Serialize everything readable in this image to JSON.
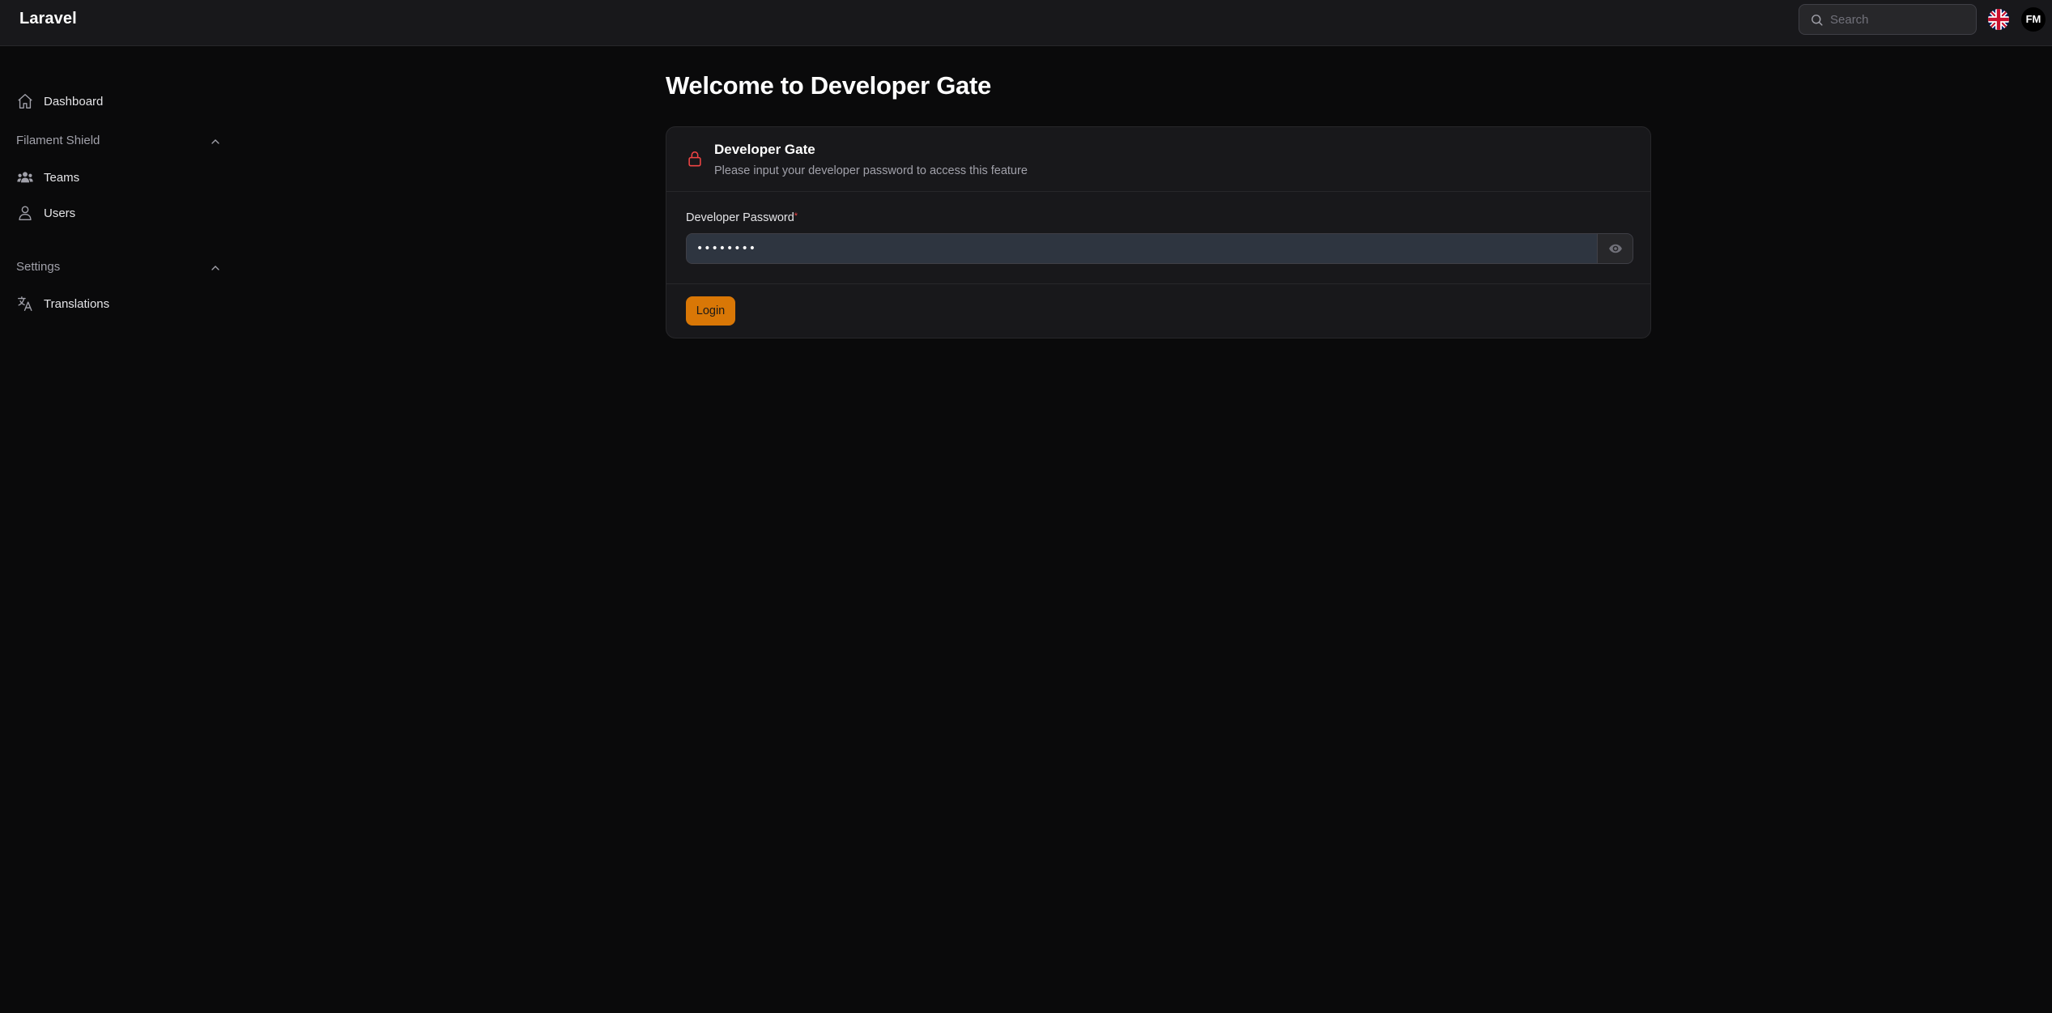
{
  "app": {
    "brand": "Laravel"
  },
  "topbar": {
    "search_placeholder": "Search",
    "avatar_initials": "FM"
  },
  "sidebar": {
    "dashboard": "Dashboard",
    "groups": [
      {
        "label": "Filament Shield",
        "items": [
          "Teams",
          "Users"
        ]
      },
      {
        "label": "Settings",
        "items": [
          "Translations"
        ]
      }
    ]
  },
  "main": {
    "title": "Welcome to Developer Gate",
    "card": {
      "title": "Developer Gate",
      "description": "Please input your developer password to access this feature",
      "field_label": "Developer Password",
      "required_mark": "*",
      "password_value": "••••••••",
      "login_label": "Login"
    }
  },
  "colors": {
    "accent": "#d97706",
    "danger": "#ef4444",
    "background": "#0a0a0b",
    "surface": "#18181b"
  },
  "icons": [
    "search-icon",
    "uk-flag-icon",
    "home-icon",
    "chevron-up-icon",
    "users-group-icon",
    "user-icon",
    "language-icon",
    "lock-icon",
    "eye-icon"
  ]
}
